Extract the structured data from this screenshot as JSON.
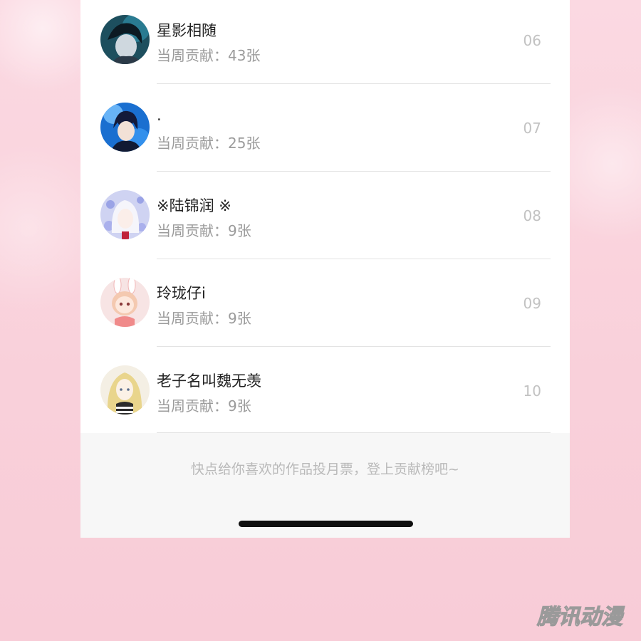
{
  "contributors": [
    {
      "name": "星影相随",
      "contribution": "当周贡献：43张",
      "rank": "06",
      "avatar_icon": "avatar-dark-hair-boy"
    },
    {
      "name": ".",
      "contribution": "当周贡献：25张",
      "rank": "07",
      "avatar_icon": "avatar-anime-boy-blue"
    },
    {
      "name": "※陆锦润 ※",
      "contribution": "当周贡献：9张",
      "rank": "08",
      "avatar_icon": "avatar-white-hair-girl"
    },
    {
      "name": "玲珑仔i",
      "contribution": "当周贡献：9张",
      "rank": "09",
      "avatar_icon": "avatar-bunny-girl-pink"
    },
    {
      "name": "老子名叫魏无羡",
      "contribution": "当周贡献：9张",
      "rank": "10",
      "avatar_icon": "avatar-blonde-girl"
    }
  ],
  "footer": {
    "hint": "快点给你喜欢的作品投月票，登上贡献榜吧~"
  },
  "watermark": {
    "text": "腾讯动漫"
  },
  "colors": {
    "background": "#f9d0da",
    "panel": "#ffffff",
    "footer": "#f7f7f7",
    "name_text": "#222222",
    "secondary_text": "#9b9b9b",
    "rank_text": "#c2c2c2"
  }
}
